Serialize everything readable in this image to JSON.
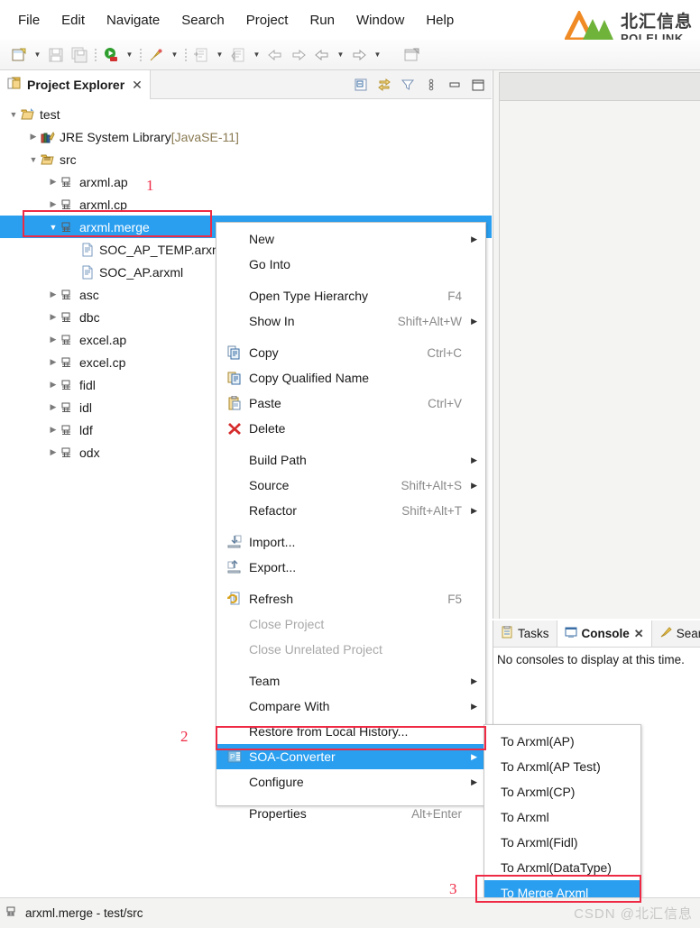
{
  "menubar": {
    "items": [
      {
        "label": "File"
      },
      {
        "label": "Edit"
      },
      {
        "label": "Navigate"
      },
      {
        "label": "Search"
      },
      {
        "label": "Project"
      },
      {
        "label": "Run"
      },
      {
        "label": "Window"
      },
      {
        "label": "Help"
      }
    ]
  },
  "logo": {
    "cn": "北汇信息",
    "en": "POLELINK",
    "orange": "#F08A24",
    "green": "#6FB33B"
  },
  "toolbar": {
    "items": [
      {
        "icon": "new-wizard-icon",
        "type": "button"
      },
      {
        "icon": "chevron-down-icon",
        "type": "arrow"
      },
      {
        "icon": "save-icon",
        "type": "button"
      },
      {
        "icon": "save-all-icon",
        "type": "button"
      },
      {
        "icon": "separator",
        "type": "sep"
      },
      {
        "icon": "run-icon",
        "type": "button"
      },
      {
        "icon": "chevron-down-icon",
        "type": "arrow"
      },
      {
        "icon": "separator",
        "type": "sep"
      },
      {
        "icon": "debug-icon",
        "type": "button"
      },
      {
        "icon": "chevron-down-icon",
        "type": "arrow"
      },
      {
        "icon": "separator",
        "type": "sep"
      },
      {
        "icon": "new-java-class-icon",
        "type": "button"
      },
      {
        "icon": "chevron-down-icon",
        "type": "arrow"
      },
      {
        "icon": "new-java-package-icon",
        "type": "button"
      },
      {
        "icon": "chevron-down-icon",
        "type": "arrow"
      },
      {
        "icon": "back-icon",
        "type": "button"
      },
      {
        "icon": "forward-icon",
        "type": "button"
      },
      {
        "icon": "previous-annotation-icon",
        "type": "button"
      },
      {
        "icon": "chevron-down-icon",
        "type": "arrow"
      },
      {
        "icon": "next-annotation-icon",
        "type": "button"
      },
      {
        "icon": "chevron-down-icon",
        "type": "arrow"
      },
      {
        "icon": "open-perspective-icon",
        "type": "button"
      }
    ]
  },
  "project_explorer": {
    "tab_label": "Project Explorer",
    "tab_close": "✕",
    "tools": [
      {
        "name": "collapse-all-icon"
      },
      {
        "name": "link-with-editor-icon"
      },
      {
        "name": "filter-icon"
      },
      {
        "name": "view-menu-icon"
      },
      {
        "name": "minimize-icon"
      },
      {
        "name": "maximize-icon"
      }
    ],
    "tree": [
      {
        "label": "test",
        "suffix": "",
        "indent": 0,
        "twist": "down",
        "icon": "project-icon",
        "selected": false
      },
      {
        "label": "JRE System Library",
        "suffix": " [JavaSE-11]",
        "indent": 1,
        "twist": "right",
        "icon": "library-icon",
        "selected": false
      },
      {
        "label": "src",
        "suffix": "",
        "indent": 1,
        "twist": "down",
        "icon": "source-folder-icon",
        "selected": false
      },
      {
        "label": "arxml.ap",
        "suffix": "",
        "indent": 2,
        "twist": "right",
        "icon": "package-icon",
        "selected": false
      },
      {
        "label": "arxml.cp",
        "suffix": "",
        "indent": 2,
        "twist": "right",
        "icon": "package-icon",
        "selected": false
      },
      {
        "label": "arxml.merge",
        "suffix": "",
        "indent": 2,
        "twist": "down",
        "icon": "package-icon",
        "selected": true
      },
      {
        "label": "SOC_AP_TEMP.arxml",
        "suffix": "",
        "indent": 3,
        "twist": "none",
        "icon": "file-icon",
        "selected": false
      },
      {
        "label": "SOC_AP.arxml",
        "suffix": "",
        "indent": 3,
        "twist": "none",
        "icon": "file-icon",
        "selected": false
      },
      {
        "label": "asc",
        "suffix": "",
        "indent": 2,
        "twist": "right",
        "icon": "package-icon",
        "selected": false
      },
      {
        "label": "dbc",
        "suffix": "",
        "indent": 2,
        "twist": "right",
        "icon": "package-icon",
        "selected": false
      },
      {
        "label": "excel.ap",
        "suffix": "",
        "indent": 2,
        "twist": "right",
        "icon": "package-icon",
        "selected": false
      },
      {
        "label": "excel.cp",
        "suffix": "",
        "indent": 2,
        "twist": "right",
        "icon": "package-icon",
        "selected": false
      },
      {
        "label": "fidl",
        "suffix": "",
        "indent": 2,
        "twist": "right",
        "icon": "package-icon",
        "selected": false
      },
      {
        "label": "idl",
        "suffix": "",
        "indent": 2,
        "twist": "right",
        "icon": "package-icon",
        "selected": false
      },
      {
        "label": "ldf",
        "suffix": "",
        "indent": 2,
        "twist": "right",
        "icon": "package-icon",
        "selected": false
      },
      {
        "label": "odx",
        "suffix": "",
        "indent": 2,
        "twist": "right",
        "icon": "package-icon",
        "selected": false
      }
    ]
  },
  "context_menu": {
    "items": [
      {
        "label": "New",
        "accel": "",
        "icon": "",
        "submenu": true,
        "disabled": false,
        "highlighted": false,
        "gap": false
      },
      {
        "label": "Go Into",
        "accel": "",
        "icon": "",
        "submenu": false,
        "disabled": false,
        "highlighted": false,
        "gap": false
      },
      {
        "label": "Open Type Hierarchy",
        "accel": "F4",
        "icon": "",
        "submenu": false,
        "disabled": false,
        "highlighted": false,
        "gap": true
      },
      {
        "label": "Show In",
        "accel": "Shift+Alt+W",
        "icon": "",
        "submenu": true,
        "disabled": false,
        "highlighted": false,
        "gap": false
      },
      {
        "label": "Copy",
        "accel": "Ctrl+C",
        "icon": "copy-icon",
        "submenu": false,
        "disabled": false,
        "highlighted": false,
        "gap": true
      },
      {
        "label": "Copy Qualified Name",
        "accel": "",
        "icon": "copy-qualified-name-icon",
        "submenu": false,
        "disabled": false,
        "highlighted": false,
        "gap": false
      },
      {
        "label": "Paste",
        "accel": "Ctrl+V",
        "icon": "paste-icon",
        "submenu": false,
        "disabled": false,
        "highlighted": false,
        "gap": false
      },
      {
        "label": "Delete",
        "accel": "",
        "icon": "delete-icon",
        "submenu": false,
        "disabled": false,
        "highlighted": false,
        "gap": false
      },
      {
        "label": "Build Path",
        "accel": "",
        "icon": "",
        "submenu": true,
        "disabled": false,
        "highlighted": false,
        "gap": true
      },
      {
        "label": "Source",
        "accel": "Shift+Alt+S",
        "icon": "",
        "submenu": true,
        "disabled": false,
        "highlighted": false,
        "gap": false
      },
      {
        "label": "Refactor",
        "accel": "Shift+Alt+T",
        "icon": "",
        "submenu": true,
        "disabled": false,
        "highlighted": false,
        "gap": false
      },
      {
        "label": "Import...",
        "accel": "",
        "icon": "import-icon",
        "submenu": false,
        "disabled": false,
        "highlighted": false,
        "gap": true
      },
      {
        "label": "Export...",
        "accel": "",
        "icon": "export-icon",
        "submenu": false,
        "disabled": false,
        "highlighted": false,
        "gap": false
      },
      {
        "label": "Refresh",
        "accel": "F5",
        "icon": "refresh-icon",
        "submenu": false,
        "disabled": false,
        "highlighted": false,
        "gap": true
      },
      {
        "label": "Close Project",
        "accel": "",
        "icon": "",
        "submenu": false,
        "disabled": true,
        "highlighted": false,
        "gap": false
      },
      {
        "label": "Close Unrelated Project",
        "accel": "",
        "icon": "",
        "submenu": false,
        "disabled": true,
        "highlighted": false,
        "gap": false
      },
      {
        "label": "Team",
        "accel": "",
        "icon": "",
        "submenu": true,
        "disabled": false,
        "highlighted": false,
        "gap": true
      },
      {
        "label": "Compare With",
        "accel": "",
        "icon": "",
        "submenu": true,
        "disabled": false,
        "highlighted": false,
        "gap": false
      },
      {
        "label": "Restore from Local History...",
        "accel": "",
        "icon": "",
        "submenu": false,
        "disabled": false,
        "highlighted": false,
        "gap": false
      },
      {
        "label": "SOA-Converter",
        "accel": "",
        "icon": "soa-converter-icon",
        "submenu": true,
        "disabled": false,
        "highlighted": true,
        "gap": false
      },
      {
        "label": "Configure",
        "accel": "",
        "icon": "",
        "submenu": true,
        "disabled": false,
        "highlighted": false,
        "gap": false
      },
      {
        "label": "Properties",
        "accel": "Alt+Enter",
        "icon": "",
        "submenu": false,
        "disabled": false,
        "highlighted": false,
        "gap": true
      }
    ]
  },
  "submenu": {
    "items": [
      {
        "label": "To Arxml(AP)",
        "highlighted": false
      },
      {
        "label": "To Arxml(AP Test)",
        "highlighted": false
      },
      {
        "label": "To Arxml(CP)",
        "highlighted": false
      },
      {
        "label": "To Arxml",
        "highlighted": false
      },
      {
        "label": "To Arxml(Fidl)",
        "highlighted": false
      },
      {
        "label": "To Arxml(DataType)",
        "highlighted": false
      },
      {
        "label": "To Merge Arxml",
        "highlighted": true
      }
    ]
  },
  "bottom_view": {
    "tabs": [
      {
        "label": "Tasks",
        "icon": "tasks-icon",
        "active": false,
        "closable": false
      },
      {
        "label": "Console",
        "icon": "console-icon",
        "active": true,
        "closable": true
      },
      {
        "label": "Search",
        "icon": "search-icon",
        "active": false,
        "closable": false
      }
    ],
    "close_glyph": "✕",
    "message": "No consoles to display at this time."
  },
  "statusbar": {
    "icon": "package-icon",
    "text": "arxml.merge - test/src"
  },
  "annotations": [
    {
      "number": "1"
    },
    {
      "number": "2"
    },
    {
      "number": "3"
    }
  ],
  "watermark": {
    "text": "CSDN @北汇信息"
  },
  "colors": {
    "selection_blue": "#2A9FF0",
    "annotation_red": "#EF2A45"
  }
}
